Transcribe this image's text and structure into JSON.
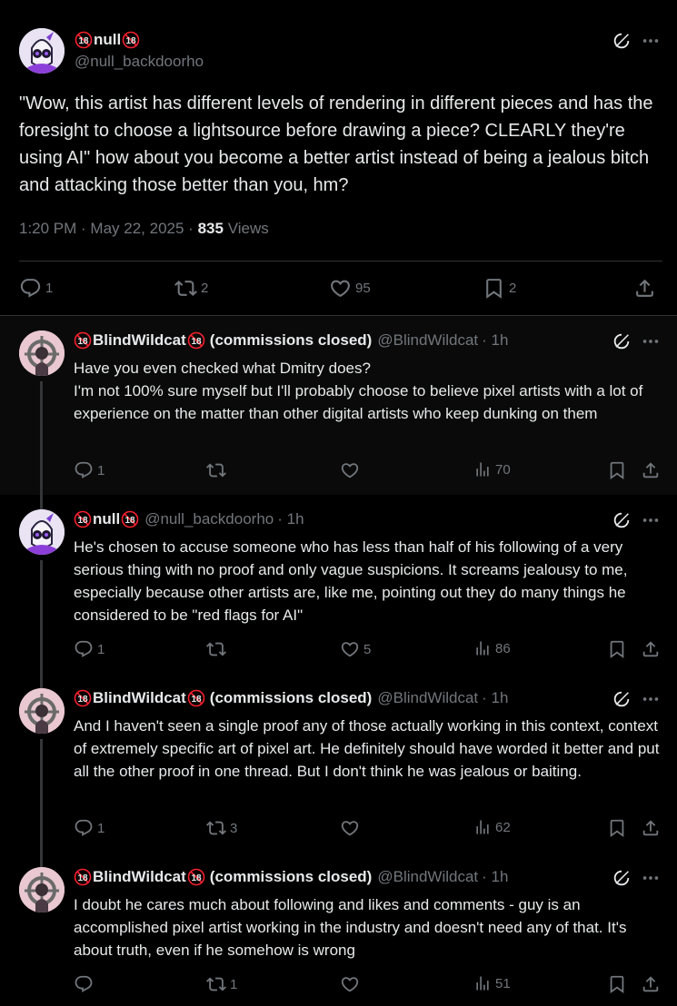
{
  "main": {
    "name": "null",
    "handle": "@null_backdoorho",
    "text": "\"Wow, this artist has different levels of rendering in different pieces and has the foresight to choose a lightsource before drawing a piece? CLEARLY they're using AI\" how about you become a better artist instead of being a jealous bitch and attacking those better than you, hm?",
    "timestamp": "1:20 PM · May 22, 2025",
    "separator": "·",
    "views_count": "835",
    "views_label": "Views",
    "replies": "1",
    "reposts": "2",
    "likes": "95",
    "bookmarks": "2"
  },
  "replies": [
    {
      "name": "BlindWildcat",
      "name_suffix": "(commissions closed)",
      "handle": "@BlindWildcat",
      "time": "· 1h",
      "text": "Have you even checked what Dmitry does?\nI'm not 100% sure myself but I'll probably choose to believe pixel artists with a lot of experience on the matter than other digital artists who keep dunking on them",
      "replies": "1",
      "reposts": "",
      "likes": "",
      "views": "70"
    },
    {
      "name": "null",
      "name_suffix": "",
      "handle": "@null_backdoorho",
      "time": "· 1h",
      "text": "He's chosen to accuse someone who has less than half of his following of a very serious thing with no proof and only vague suspicions. It screams jealousy to me, especially because other artists are, like me, pointing out they do many things he considered to be \"red flags for AI\"",
      "replies": "1",
      "reposts": "",
      "likes": "5",
      "views": "86"
    },
    {
      "name": "BlindWildcat",
      "name_suffix": "(commissions closed)",
      "handle": "@BlindWildcat",
      "time": "· 1h",
      "text": "And I haven't seen a single proof any of those actually working in this context, context of extremely specific art of pixel art. He definitely should have worded it better and put all the other proof in one thread. But I don't think he was jealous or baiting.",
      "replies": "1",
      "reposts": "3",
      "likes": "",
      "views": "62"
    },
    {
      "name": "BlindWildcat",
      "name_suffix": "(commissions closed)",
      "handle": "@BlindWildcat",
      "time": "· 1h",
      "text": "I doubt he cares much about following and likes and comments - guy is an accomplished pixel artist working in the industry and doesn't need any of that. It's about truth, even if he somehow is wrong",
      "replies": "",
      "reposts": "1",
      "likes": "",
      "views": "51"
    }
  ],
  "badge_text": "18",
  "colors": {
    "background": "#000000",
    "text": "#e7e9ea",
    "muted": "#71767b",
    "divider": "#2f3336",
    "badge_red": "#f4212e",
    "reply_bg_highlight": "#16181c"
  },
  "icons": {
    "reply": "reply-icon",
    "repost": "repost-icon",
    "like": "heart-icon",
    "bookmark": "bookmark-icon",
    "share": "share-icon",
    "views": "views-icon",
    "grok": "grok-icon",
    "more": "more-icon",
    "badge": "eighteen-badge-icon"
  }
}
